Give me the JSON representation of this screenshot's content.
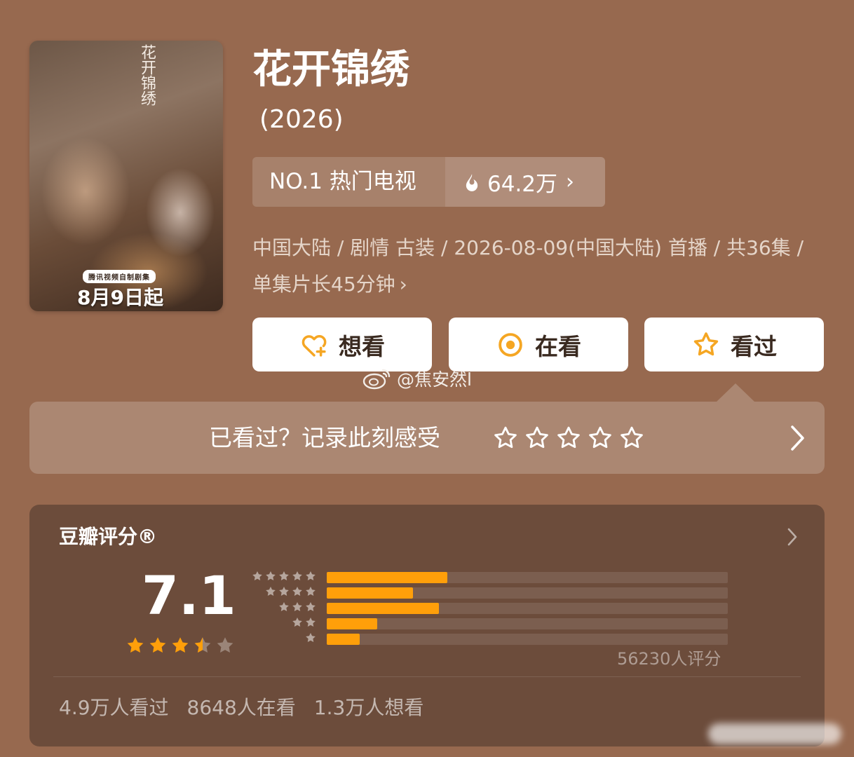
{
  "poster": {
    "calligraphy": "花开锦绣",
    "platform_tag": "腾讯视频自制剧集",
    "premiere_text": "8月9日起"
  },
  "title": "花开锦绣",
  "year": "(2026)",
  "rank": {
    "label": "NO.1 热门电视",
    "heat": "64.2万",
    "chevron": "›"
  },
  "meta_text": "中国大陆 / 剧情 古装 / 2026-08-09(中国大陆) 首播 / 共36集 / 单集片长45分钟",
  "meta_chevron": "›",
  "actions": {
    "want": "想看",
    "watching": "在看",
    "watched": "看过"
  },
  "watermark": "@焦安然l",
  "rate_prompt": {
    "text": "已看过？记录此刻感受",
    "star_count": 5
  },
  "douban": {
    "title": "豆瓣评分®",
    "score": "7.1",
    "stars_filled": 3.5,
    "distribution": [
      {
        "stars": 5,
        "fraction": 0.3
      },
      {
        "stars": 4,
        "fraction": 0.215
      },
      {
        "stars": 3,
        "fraction": 0.28
      },
      {
        "stars": 2,
        "fraction": 0.125
      },
      {
        "stars": 1,
        "fraction": 0.083
      }
    ],
    "rating_count": "56230人评分",
    "stats": {
      "watched": "4.9万人看过",
      "watching": "8648人在看",
      "want": "1.3万人想看"
    }
  },
  "colors": {
    "background": "#97694f",
    "card": "#6c4c3b",
    "accent": "#ff9f0a",
    "button_text": "#3a2a20"
  }
}
